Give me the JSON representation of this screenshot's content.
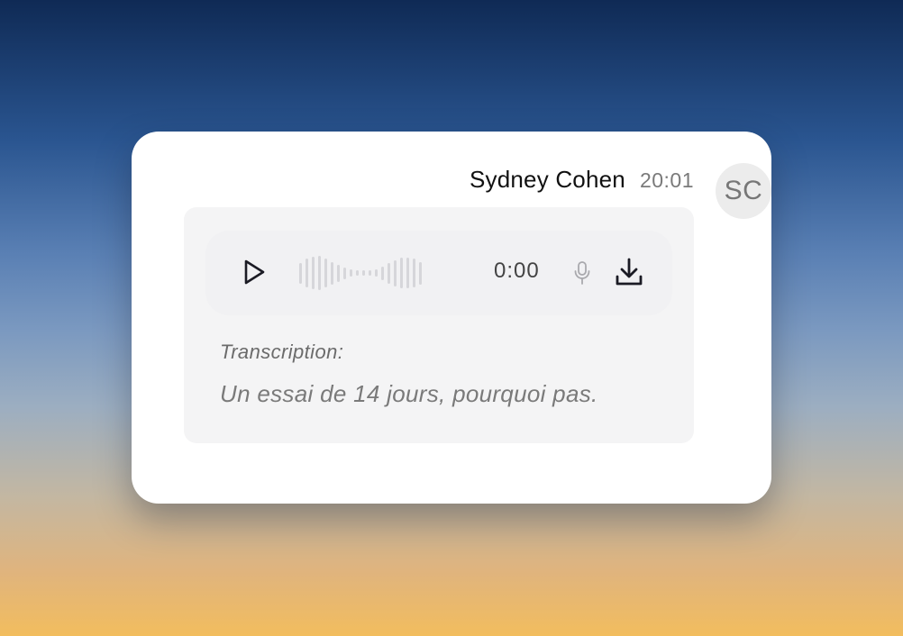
{
  "message": {
    "sender_name": "Sydney Cohen",
    "time": "20:01",
    "avatar_initials": "SC"
  },
  "audio": {
    "duration": "0:00",
    "waveform_levels": [
      0.55,
      0.75,
      0.85,
      0.9,
      0.75,
      0.6,
      0.45,
      0.3,
      0.2,
      0.15,
      0.15,
      0.15,
      0.2,
      0.35,
      0.55,
      0.7,
      0.8,
      0.8,
      0.75,
      0.6
    ],
    "play_icon": "play-icon",
    "mic_icon": "microphone-icon",
    "download_icon": "download-icon"
  },
  "transcription": {
    "label": "Transcription:",
    "text": "Un essai de 14 jours, pourquoi pas."
  },
  "colors": {
    "bubble_bg": "#f4f4f5",
    "waveform": "#d6d6da",
    "icon_dark": "#1b1b24",
    "icon_muted": "#a9a9ad"
  }
}
